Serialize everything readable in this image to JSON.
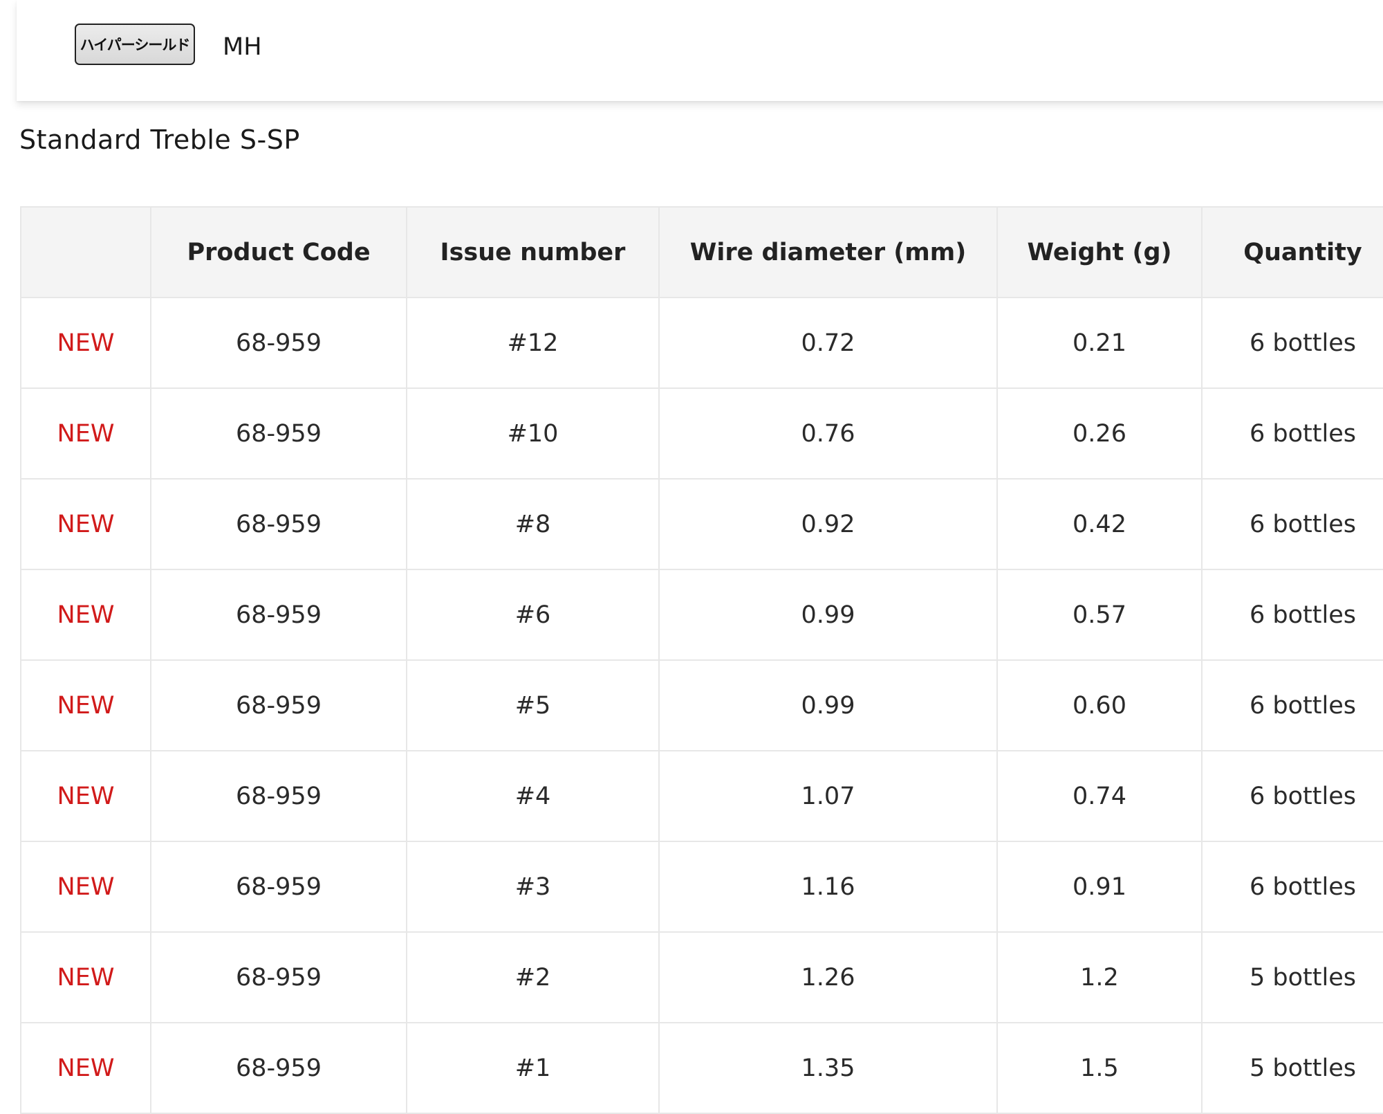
{
  "header": {
    "badge_label": "ハイパーシールド",
    "model_label": "MH"
  },
  "section": {
    "title": "Standard Treble S-SP"
  },
  "table": {
    "columns": [
      "",
      "Product Code",
      "Issue number",
      "Wire diameter (mm)",
      "Weight (g)",
      "Quantity"
    ],
    "rows": [
      {
        "tag": "NEW",
        "code": "68-959",
        "issue": "#12",
        "wire": "0.72",
        "weight": "0.21",
        "qty": "6 bottles"
      },
      {
        "tag": "NEW",
        "code": "68-959",
        "issue": "#10",
        "wire": "0.76",
        "weight": "0.26",
        "qty": "6 bottles"
      },
      {
        "tag": "NEW",
        "code": "68-959",
        "issue": "#8",
        "wire": "0.92",
        "weight": "0.42",
        "qty": "6 bottles"
      },
      {
        "tag": "NEW",
        "code": "68-959",
        "issue": "#6",
        "wire": "0.99",
        "weight": "0.57",
        "qty": "6 bottles"
      },
      {
        "tag": "NEW",
        "code": "68-959",
        "issue": "#5",
        "wire": "0.99",
        "weight": "0.60",
        "qty": "6 bottles"
      },
      {
        "tag": "NEW",
        "code": "68-959",
        "issue": "#4",
        "wire": "1.07",
        "weight": "0.74",
        "qty": "6 bottles"
      },
      {
        "tag": "NEW",
        "code": "68-959",
        "issue": "#3",
        "wire": "1.16",
        "weight": "0.91",
        "qty": "6 bottles"
      },
      {
        "tag": "NEW",
        "code": "68-959",
        "issue": "#2",
        "wire": "1.26",
        "weight": "1.2",
        "qty": "5 bottles"
      },
      {
        "tag": "NEW",
        "code": "68-959",
        "issue": "#1",
        "wire": "1.35",
        "weight": "1.5",
        "qty": "5 bottles"
      }
    ]
  },
  "colors": {
    "new_tag": "#d11a1a",
    "header_bg": "#f4f4f4",
    "border": "#e7e7e7"
  }
}
